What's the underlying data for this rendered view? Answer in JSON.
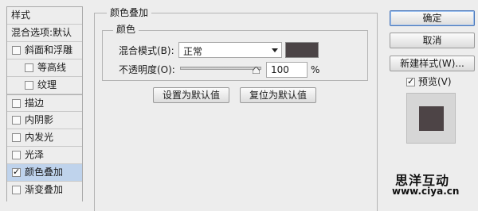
{
  "sidebar": {
    "items": [
      {
        "label": "样式"
      },
      {
        "label": "混合选项:默认"
      },
      {
        "label": "斜面和浮雕",
        "checked": false
      },
      {
        "label": "等高线",
        "checked": false
      },
      {
        "label": "纹理",
        "checked": false
      },
      {
        "label": "描边",
        "checked": false
      },
      {
        "label": "内阴影",
        "checked": false
      },
      {
        "label": "内发光",
        "checked": false
      },
      {
        "label": "光泽",
        "checked": false
      },
      {
        "label": "颜色叠加",
        "checked": true,
        "selected": true
      },
      {
        "label": "渐变叠加",
        "checked": false
      }
    ]
  },
  "panel": {
    "title": "颜色叠加",
    "color_group_title": "颜色",
    "blend_mode_label": "混合模式(B):",
    "blend_mode_value": "正常",
    "overlay_color": "#4b4446",
    "opacity_label": "不透明度(O):",
    "opacity_value": "100",
    "opacity_unit": "%",
    "opacity_fraction": 1.0,
    "set_default_label": "设置为默认值",
    "reset_default_label": "复位为默认值"
  },
  "actions": {
    "ok_label": "确定",
    "cancel_label": "取消",
    "new_style_label": "新建样式(W)...",
    "preview_label": "预览(V)",
    "preview_checked": true
  },
  "watermark": {
    "line1": "思洋互动",
    "line2": "www.ciya.cn"
  }
}
